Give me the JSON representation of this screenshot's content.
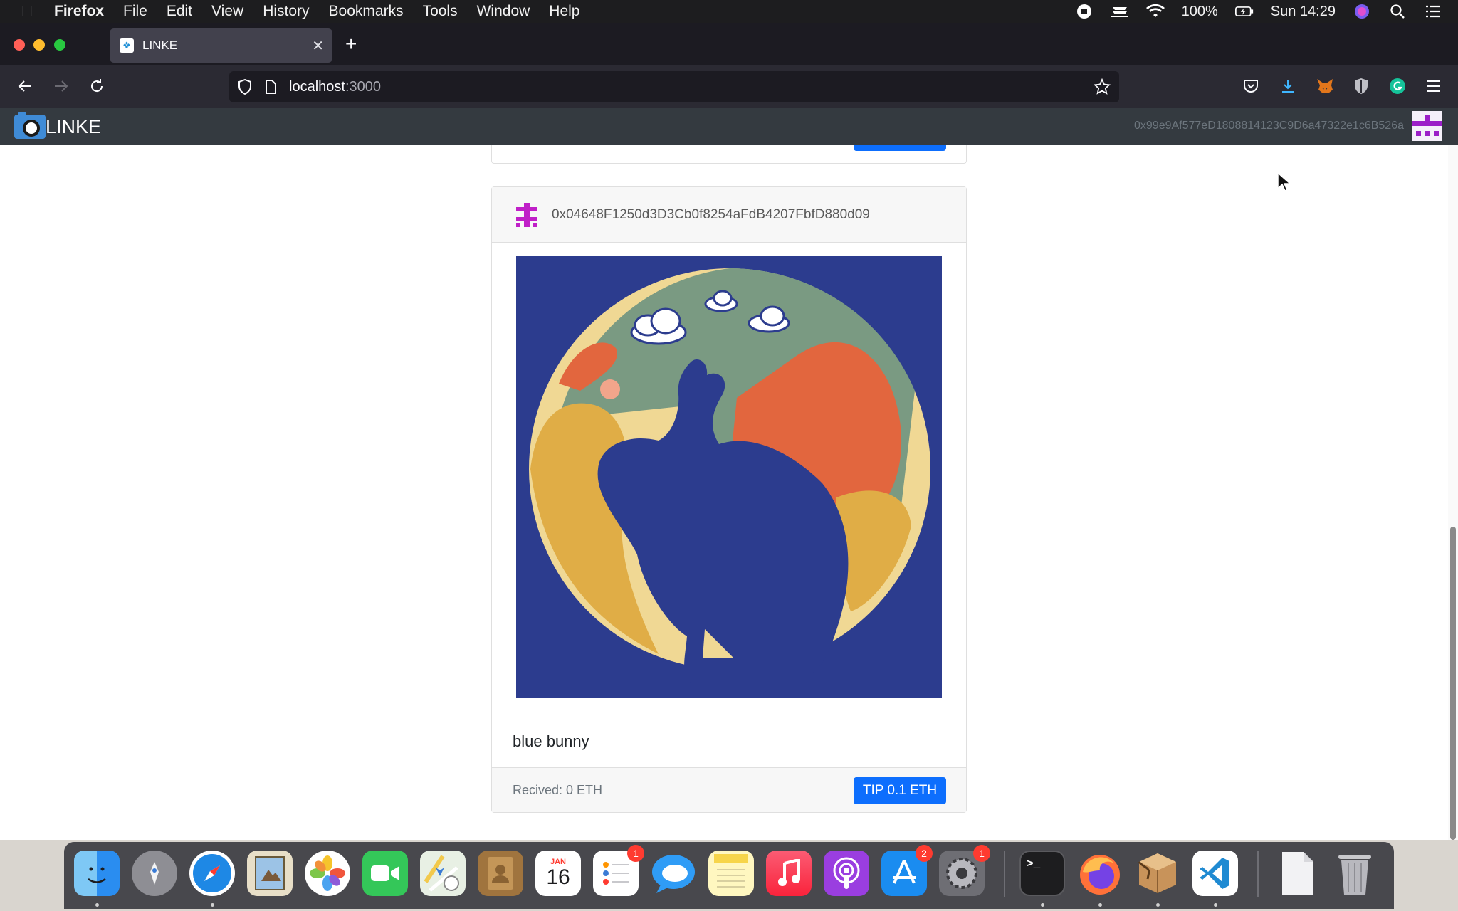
{
  "menubar": {
    "app_name": "Firefox",
    "items": [
      "File",
      "Edit",
      "View",
      "History",
      "Bookmarks",
      "Tools",
      "Window",
      "Help"
    ],
    "battery": "100%",
    "clock": "Sun 14:29"
  },
  "browser": {
    "tab_title": "LINKE",
    "url_host": "localhost",
    "url_port": ":3000"
  },
  "app": {
    "brand": "LINKE",
    "account_address": "0x99e9Af577eD1808814123C9D6a47322e1c6B526a"
  },
  "post": {
    "author": "0x04648F1250d3D3Cb0f8254aFdB4207FbfD880d09",
    "caption": "blue bunny",
    "received": "Recived: 0 ETH",
    "tip_label": "TIP 0.1 ETH"
  },
  "dock": {
    "calendar_month": "JAN",
    "calendar_day": "16",
    "reminders_badge": "1",
    "appstore_badge": "2",
    "settings_badge": "1",
    "terminal_prompt": ">_"
  },
  "colors": {
    "menubar_bg": "#1d1d1f",
    "app_header_bg": "#343a40",
    "primary_button": "#0d6efd",
    "identicon": "#c020c8",
    "image_bg": "#2c3c8e"
  }
}
